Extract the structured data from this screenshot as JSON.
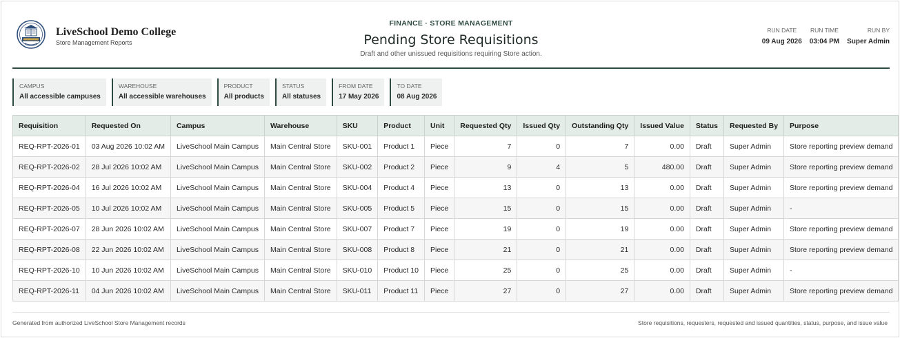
{
  "org": {
    "name": "LiveSchool Demo College",
    "subtitle": "Store Management Reports"
  },
  "report": {
    "kicker": "FINANCE · STORE MANAGEMENT",
    "title": "Pending Store Requisitions",
    "subtitle": "Draft and other unissued requisitions requiring Store action."
  },
  "run": [
    {
      "label": "RUN DATE",
      "value": "09 Aug 2026"
    },
    {
      "label": "RUN TIME",
      "value": "03:04 PM"
    },
    {
      "label": "RUN BY",
      "value": "Super Admin"
    }
  ],
  "filters": [
    {
      "label": "CAMPUS",
      "value": "All accessible campuses"
    },
    {
      "label": "WAREHOUSE",
      "value": "All accessible warehouses"
    },
    {
      "label": "PRODUCT",
      "value": "All products"
    },
    {
      "label": "STATUS",
      "value": "All statuses"
    },
    {
      "label": "FROM DATE",
      "value": "17 May 2026"
    },
    {
      "label": "TO DATE",
      "value": "08 Aug 2026"
    }
  ],
  "table": {
    "columns": [
      "Requisition",
      "Requested On",
      "Campus",
      "Warehouse",
      "SKU",
      "Product",
      "Unit",
      "Requested Qty",
      "Issued Qty",
      "Outstanding Qty",
      "Issued Value",
      "Status",
      "Requested By",
      "Purpose"
    ],
    "rows": [
      [
        "REQ-RPT-2026-01",
        "03 Aug 2026 10:02 AM",
        "LiveSchool Main Campus",
        "Main Central Store",
        "SKU-001",
        "Product 1",
        "Piece",
        "7",
        "0",
        "7",
        "0.00",
        "Draft",
        "Super Admin",
        "Store reporting preview demand"
      ],
      [
        "REQ-RPT-2026-02",
        "28 Jul 2026 10:02 AM",
        "LiveSchool Main Campus",
        "Main Central Store",
        "SKU-002",
        "Product 2",
        "Piece",
        "9",
        "4",
        "5",
        "480.00",
        "Draft",
        "Super Admin",
        "Store reporting preview demand"
      ],
      [
        "REQ-RPT-2026-04",
        "16 Jul 2026 10:02 AM",
        "LiveSchool Main Campus",
        "Main Central Store",
        "SKU-004",
        "Product 4",
        "Piece",
        "13",
        "0",
        "13",
        "0.00",
        "Draft",
        "Super Admin",
        "Store reporting preview demand"
      ],
      [
        "REQ-RPT-2026-05",
        "10 Jul 2026 10:02 AM",
        "LiveSchool Main Campus",
        "Main Central Store",
        "SKU-005",
        "Product 5",
        "Piece",
        "15",
        "0",
        "15",
        "0.00",
        "Draft",
        "Super Admin",
        "-"
      ],
      [
        "REQ-RPT-2026-07",
        "28 Jun 2026 10:02 AM",
        "LiveSchool Main Campus",
        "Main Central Store",
        "SKU-007",
        "Product 7",
        "Piece",
        "19",
        "0",
        "19",
        "0.00",
        "Draft",
        "Super Admin",
        "Store reporting preview demand"
      ],
      [
        "REQ-RPT-2026-08",
        "22 Jun 2026 10:02 AM",
        "LiveSchool Main Campus",
        "Main Central Store",
        "SKU-008",
        "Product 8",
        "Piece",
        "21",
        "0",
        "21",
        "0.00",
        "Draft",
        "Super Admin",
        "Store reporting preview demand"
      ],
      [
        "REQ-RPT-2026-10",
        "10 Jun 2026 10:02 AM",
        "LiveSchool Main Campus",
        "Main Central Store",
        "SKU-010",
        "Product 10",
        "Piece",
        "25",
        "0",
        "25",
        "0.00",
        "Draft",
        "Super Admin",
        "-"
      ],
      [
        "REQ-RPT-2026-11",
        "04 Jun 2026 10:02 AM",
        "LiveSchool Main Campus",
        "Main Central Store",
        "SKU-011",
        "Product 11",
        "Piece",
        "27",
        "0",
        "27",
        "0.00",
        "Draft",
        "Super Admin",
        "Store reporting preview demand"
      ]
    ]
  },
  "footer": {
    "left": "Generated from authorized LiveSchool Store Management records",
    "right": "Store requisitions, requesters, requested and issued quantities, status, purpose, and issue value"
  },
  "colors": {
    "accent": "#2f4a3f",
    "header_bg": "#e3ece6",
    "chip_bg": "#eef1ef"
  }
}
